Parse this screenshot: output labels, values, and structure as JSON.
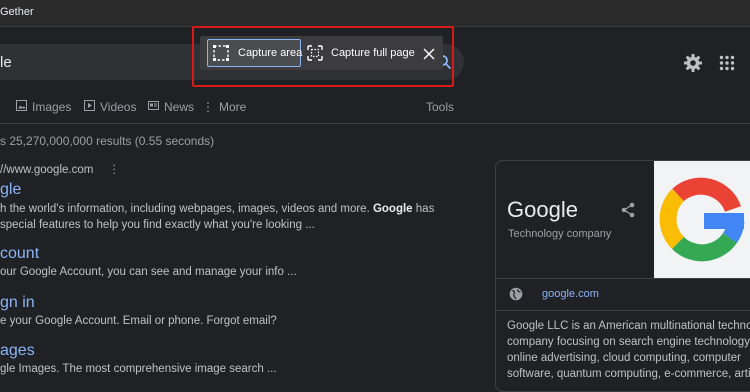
{
  "window": {
    "title": "Gether"
  },
  "search": {
    "query": "le"
  },
  "tabs": [
    {
      "label": "Images"
    },
    {
      "label": "Videos"
    },
    {
      "label": "News"
    },
    {
      "label": "More"
    }
  ],
  "tools_label": "Tools",
  "stats": "s 25,270,000,000 results (0.55 seconds)",
  "results": [
    {
      "url": "//www.google.com",
      "title": "gle",
      "snippet1_a": "h the world's information, including webpages, images, videos and more. ",
      "snippet1_b": "Google",
      "snippet1_c": " has",
      "snippet2": "special features to help you find exactly what you're looking ..."
    },
    {
      "title": "count",
      "snippet": "our Google Account, you can see and manage your info ..."
    },
    {
      "title": "gn in",
      "snippet": "e your Google Account. Email or phone. Forgot email?"
    },
    {
      "title": "ages",
      "snippet": "gle Images. The most comprehensive image search ..."
    }
  ],
  "knowledge_panel": {
    "title": "Google",
    "subtitle": "Technology company",
    "website": "google.com",
    "description_lines": [
      "Google LLC is an American multinational technology",
      "company focusing on search engine technology,",
      "online advertising, cloud computing, computer",
      "software, quantum computing, e-commerce, artificial"
    ]
  },
  "capture_toolbar": {
    "capture_area_label": "Capture area",
    "capture_full_page_label": "Capture full page"
  },
  "colors": {
    "background": "#202124",
    "link": "#8ab4f8",
    "highlight": "#d91a1a"
  }
}
